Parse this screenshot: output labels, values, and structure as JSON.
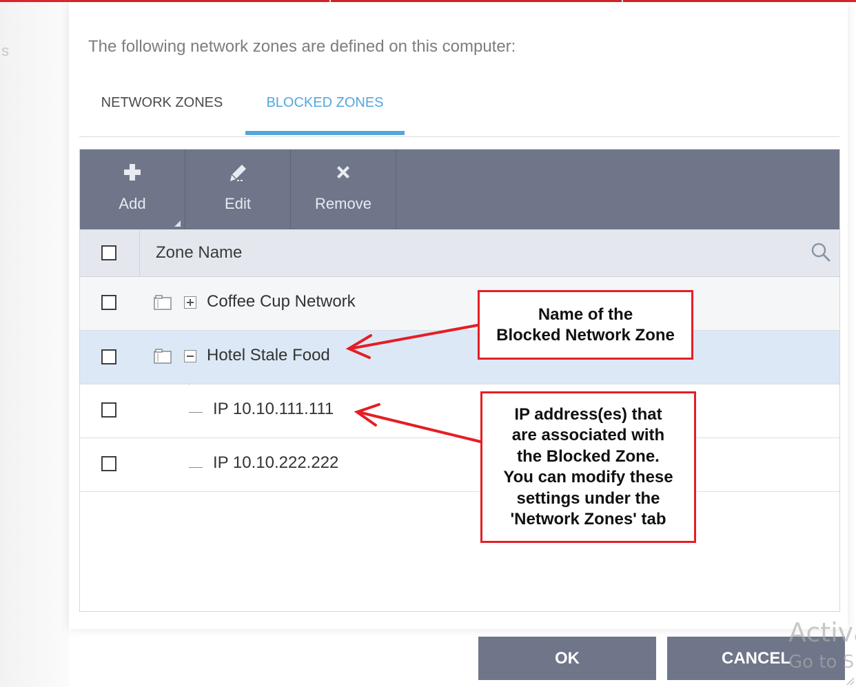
{
  "background_app": {
    "partial_text": "s"
  },
  "dialog": {
    "intro": "The following network zones are defined on this computer:",
    "tabs": [
      {
        "label": "NETWORK ZONES",
        "active": false
      },
      {
        "label": "BLOCKED ZONES",
        "active": true
      }
    ],
    "toolbar": {
      "add": {
        "label": "Add",
        "icon": "plus-icon"
      },
      "edit": {
        "label": "Edit",
        "icon": "pencil-icon"
      },
      "remove": {
        "label": "Remove",
        "icon": "x-icon"
      }
    },
    "table": {
      "column_header": "Zone Name",
      "rows": [
        {
          "label": "Coffee Cup Network",
          "type": "zone",
          "expanded": false,
          "selected": false
        },
        {
          "label": "Hotel Stale Food",
          "type": "zone",
          "expanded": true,
          "selected": true
        },
        {
          "label": "IP 10.10.111.111",
          "type": "ip",
          "selected": false
        },
        {
          "label": "IP 10.10.222.222",
          "type": "ip",
          "selected": false
        }
      ]
    },
    "buttons": {
      "ok": "OK",
      "cancel": "CANCEL"
    }
  },
  "annotations": {
    "callout_zone_name": "Name of the\nBlocked Network Zone",
    "callout_ip": "IP address(es) that\nare associated with\nthe Blocked Zone.\nYou can modify these\nsettings under the\n'Network Zones' tab"
  },
  "watermark": {
    "line1": "Activa",
    "line2": "Go to S"
  },
  "colors": {
    "accent_blue": "#53a6dc",
    "toolbar_bg": "#6f7689",
    "top_bar_red": "#d9262b",
    "callout_red": "#e41e25",
    "selected_row": "#dce8f5"
  }
}
